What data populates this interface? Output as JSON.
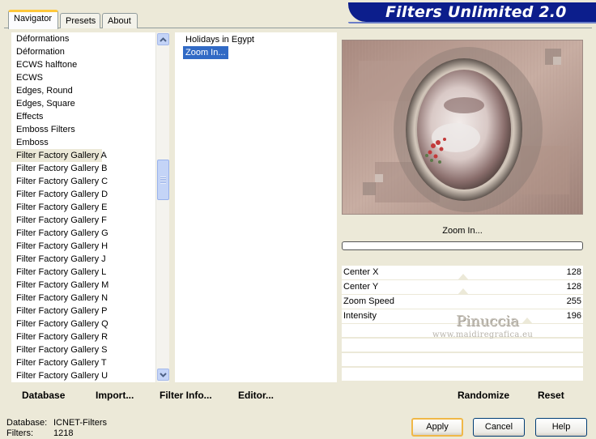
{
  "tabs": [
    {
      "label": "Navigator",
      "active": true
    },
    {
      "label": "Presets",
      "active": false
    },
    {
      "label": "About",
      "active": false
    }
  ],
  "banner": {
    "title": "Filters Unlimited 2.0",
    "color": "#0c1e8c"
  },
  "categories": {
    "items": [
      "Déformations",
      "Déformation",
      "ECWS halftone",
      "ECWS",
      "Edges, Round",
      "Edges, Square",
      "Effects",
      "Emboss Filters",
      "Emboss",
      "Filter Factory Gallery A",
      "Filter Factory Gallery B",
      "Filter Factory Gallery C",
      "Filter Factory Gallery D",
      "Filter Factory Gallery E",
      "Filter Factory Gallery F",
      "Filter Factory Gallery G",
      "Filter Factory Gallery H",
      "Filter Factory Gallery J",
      "Filter Factory Gallery L",
      "Filter Factory Gallery M",
      "Filter Factory Gallery N",
      "Filter Factory Gallery P",
      "Filter Factory Gallery Q",
      "Filter Factory Gallery R",
      "Filter Factory Gallery S",
      "Filter Factory Gallery T",
      "Filter Factory Gallery U"
    ],
    "selected": "Filter Factory Gallery A"
  },
  "filters": {
    "items": [
      "Holidays in Egypt",
      "Zoom In..."
    ],
    "selected": "Zoom In..."
  },
  "preview": {
    "filter_name": "Zoom In...",
    "progress": 0
  },
  "params": [
    {
      "label": "Center X",
      "value": "128",
      "level": 128
    },
    {
      "label": "Center Y",
      "value": "128",
      "level": 128
    },
    {
      "label": "Zoom Speed",
      "value": "255",
      "level": 255
    },
    {
      "label": "Intensity",
      "value": "196",
      "level": 196
    }
  ],
  "watermark": {
    "name": "Pinuccia",
    "site": "www.maidiregrafica.eu"
  },
  "toolbar_left": {
    "database": "Database",
    "import": "Import...",
    "filter_info": "Filter Info...",
    "editor": "Editor..."
  },
  "toolbar_right": {
    "randomize": "Randomize",
    "reset": "Reset"
  },
  "status": {
    "database_label": "Database:",
    "database_value": "ICNET-Filters",
    "filters_label": "Filters:",
    "filters_value": "1218"
  },
  "buttons": {
    "apply": "Apply",
    "cancel": "Cancel",
    "help": "Help"
  }
}
